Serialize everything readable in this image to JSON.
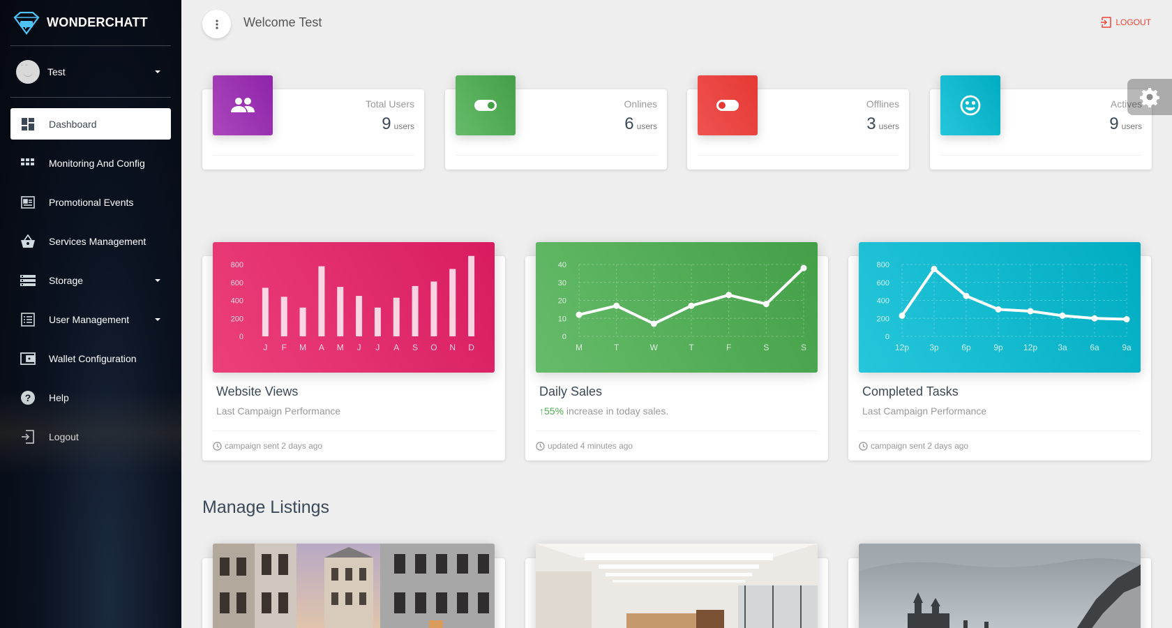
{
  "brand": {
    "name": "WONDERCHATT"
  },
  "user": {
    "name": "Test"
  },
  "nav": [
    {
      "label": "Dashboard",
      "icon": "dashboard-icon",
      "active": true
    },
    {
      "label": "Monitoring And Config",
      "icon": "grid-icon"
    },
    {
      "label": "Promotional Events",
      "icon": "newspaper-icon"
    },
    {
      "label": "Services Management",
      "icon": "basket-icon"
    },
    {
      "label": "Storage",
      "icon": "storage-icon",
      "caret": true
    },
    {
      "label": "User Management",
      "icon": "list-icon",
      "caret": true
    },
    {
      "label": "Wallet Configuration",
      "icon": "wallet-icon"
    },
    {
      "label": "Help",
      "icon": "help-icon"
    },
    {
      "label": "Logout",
      "icon": "logout-icon"
    }
  ],
  "header": {
    "welcome": "Welcome Test",
    "logout": "LOGOUT"
  },
  "stats": [
    {
      "category": "Total Users",
      "value": "9",
      "unit": "users",
      "color": "#9c27b0",
      "icon": "people-icon"
    },
    {
      "category": "Onlines",
      "value": "6",
      "unit": "users",
      "color": "#4caf50",
      "icon": "toggle-on-icon"
    },
    {
      "category": "Offlines",
      "value": "3",
      "unit": "users",
      "color": "#f44336",
      "icon": "toggle-off-icon"
    },
    {
      "category": "Actives",
      "value": "9",
      "unit": "users",
      "color": "#00bcd4",
      "icon": "smiley-icon"
    }
  ],
  "cards": [
    {
      "title": "Website Views",
      "subtitle": "Last Campaign Performance",
      "footer": "campaign sent 2 days ago"
    },
    {
      "title": "Daily Sales",
      "subtitle_percent": "55%",
      "subtitle_rest": " increase in today sales.",
      "footer": "updated 4 minutes ago"
    },
    {
      "title": "Completed Tasks",
      "subtitle": "Last Campaign Performance",
      "footer": "campaign sent 2 days ago"
    }
  ],
  "chart_data": [
    {
      "type": "bar",
      "categories": [
        "J",
        "F",
        "M",
        "A",
        "M",
        "J",
        "J",
        "A",
        "S",
        "O",
        "N",
        "D"
      ],
      "values": [
        540,
        440,
        320,
        780,
        550,
        450,
        320,
        430,
        560,
        610,
        750,
        895
      ],
      "ylim": [
        0,
        800
      ],
      "yticks": [
        "0",
        "200",
        "400",
        "600",
        "800"
      ],
      "grid": false,
      "colors": {
        "from": "#ec407a",
        "to": "#d81b60"
      }
    },
    {
      "type": "line",
      "categories": [
        "M",
        "T",
        "W",
        "T",
        "F",
        "S",
        "S"
      ],
      "values": [
        12,
        17,
        7,
        17,
        23,
        18,
        38
      ],
      "ylim": [
        0,
        40
      ],
      "yticks": [
        "0",
        "10",
        "20",
        "30",
        "40"
      ],
      "grid": true,
      "colors": {
        "from": "#66bb6a",
        "to": "#43a047"
      }
    },
    {
      "type": "line",
      "categories": [
        "12p",
        "3p",
        "6p",
        "9p",
        "12p",
        "3a",
        "6a",
        "9a"
      ],
      "values": [
        230,
        750,
        450,
        300,
        280,
        230,
        200,
        190
      ],
      "ylim": [
        0,
        800
      ],
      "yticks": [
        "0",
        "200",
        "400",
        "600",
        "800"
      ],
      "grid": true,
      "colors": {
        "from": "#26c6da",
        "to": "#00acc1"
      }
    }
  ],
  "section": {
    "title": "Manage Listings"
  }
}
